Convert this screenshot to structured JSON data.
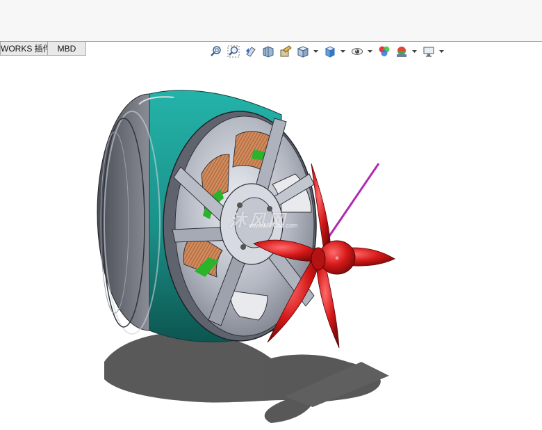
{
  "tabs": [
    {
      "label": "WORKS 插件"
    },
    {
      "label": "MBD"
    }
  ],
  "heads_up_toolbar": [
    {
      "icon": "zoom-to-fit-icon",
      "has_dropdown": false
    },
    {
      "icon": "zoom-to-area-icon",
      "has_dropdown": false
    },
    {
      "icon": "previous-view-icon",
      "has_dropdown": false
    },
    {
      "icon": "section-view-icon",
      "has_dropdown": false
    },
    {
      "icon": "dynamic-annotation-icon",
      "has_dropdown": false
    },
    {
      "icon": "view-orientation-icon",
      "has_dropdown": true
    },
    {
      "icon": "display-style-icon",
      "has_dropdown": true
    },
    {
      "icon": "hide-show-items-icon",
      "has_dropdown": true
    },
    {
      "icon": "edit-appearance-icon",
      "has_dropdown": false
    },
    {
      "icon": "apply-scene-icon",
      "has_dropdown": true
    },
    {
      "icon": "view-settings-icon",
      "has_dropdown": true
    }
  ],
  "model": {
    "watermark": "沐风网",
    "watermark_sub": "www.MFCad.com",
    "colors": {
      "stator_band": "#1a9c95",
      "rotor_gray": "#b9bcc4",
      "copper": "#c97a4e",
      "green": "#2bb32b",
      "propeller": "#d21a1a",
      "axis_line": "#b02ab0"
    }
  }
}
